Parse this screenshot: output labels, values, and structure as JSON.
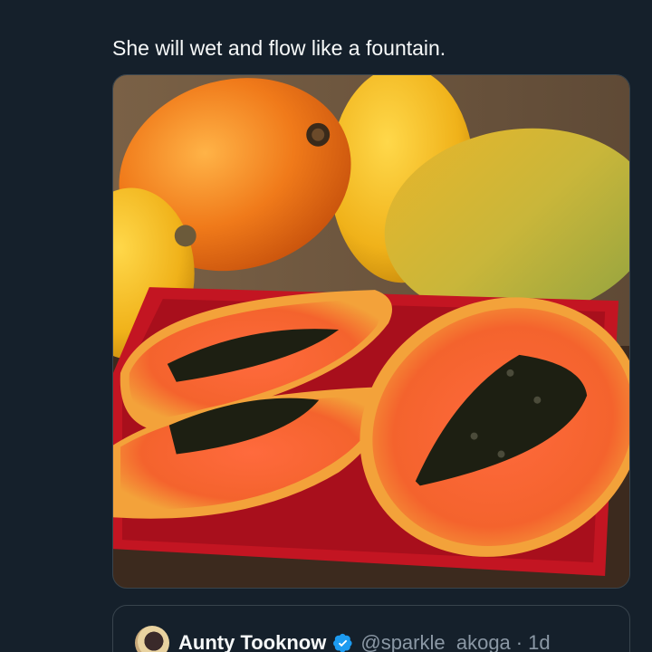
{
  "tweet": {
    "text": "She will wet and flow like a fountain."
  },
  "media": {
    "icon": "papaya-photo"
  },
  "quoted_tweet": {
    "display_name": "Aunty Tooknow",
    "handle": "@sparkle_akoga",
    "separator": "·",
    "time": "1d",
    "verified_icon": "verified-badge-icon",
    "verified_color": "#1d9bf0"
  },
  "colors": {
    "background": "#15202b",
    "border": "#38444d",
    "text_primary": "#f7f9f9",
    "text_secondary": "#8b98a5"
  }
}
